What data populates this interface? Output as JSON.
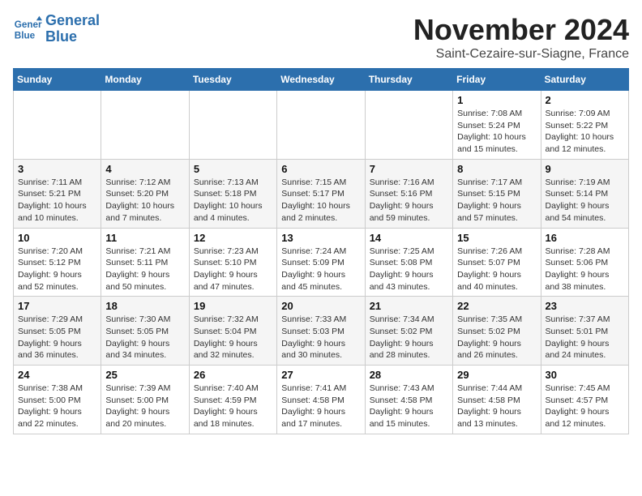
{
  "header": {
    "logo_line1": "General",
    "logo_line2": "Blue",
    "month": "November 2024",
    "location": "Saint-Cezaire-sur-Siagne, France"
  },
  "days_of_week": [
    "Sunday",
    "Monday",
    "Tuesday",
    "Wednesday",
    "Thursday",
    "Friday",
    "Saturday"
  ],
  "weeks": [
    [
      {
        "day": "",
        "info": ""
      },
      {
        "day": "",
        "info": ""
      },
      {
        "day": "",
        "info": ""
      },
      {
        "day": "",
        "info": ""
      },
      {
        "day": "",
        "info": ""
      },
      {
        "day": "1",
        "info": "Sunrise: 7:08 AM\nSunset: 5:24 PM\nDaylight: 10 hours and 15 minutes."
      },
      {
        "day": "2",
        "info": "Sunrise: 7:09 AM\nSunset: 5:22 PM\nDaylight: 10 hours and 12 minutes."
      }
    ],
    [
      {
        "day": "3",
        "info": "Sunrise: 7:11 AM\nSunset: 5:21 PM\nDaylight: 10 hours and 10 minutes."
      },
      {
        "day": "4",
        "info": "Sunrise: 7:12 AM\nSunset: 5:20 PM\nDaylight: 10 hours and 7 minutes."
      },
      {
        "day": "5",
        "info": "Sunrise: 7:13 AM\nSunset: 5:18 PM\nDaylight: 10 hours and 4 minutes."
      },
      {
        "day": "6",
        "info": "Sunrise: 7:15 AM\nSunset: 5:17 PM\nDaylight: 10 hours and 2 minutes."
      },
      {
        "day": "7",
        "info": "Sunrise: 7:16 AM\nSunset: 5:16 PM\nDaylight: 9 hours and 59 minutes."
      },
      {
        "day": "8",
        "info": "Sunrise: 7:17 AM\nSunset: 5:15 PM\nDaylight: 9 hours and 57 minutes."
      },
      {
        "day": "9",
        "info": "Sunrise: 7:19 AM\nSunset: 5:14 PM\nDaylight: 9 hours and 54 minutes."
      }
    ],
    [
      {
        "day": "10",
        "info": "Sunrise: 7:20 AM\nSunset: 5:12 PM\nDaylight: 9 hours and 52 minutes."
      },
      {
        "day": "11",
        "info": "Sunrise: 7:21 AM\nSunset: 5:11 PM\nDaylight: 9 hours and 50 minutes."
      },
      {
        "day": "12",
        "info": "Sunrise: 7:23 AM\nSunset: 5:10 PM\nDaylight: 9 hours and 47 minutes."
      },
      {
        "day": "13",
        "info": "Sunrise: 7:24 AM\nSunset: 5:09 PM\nDaylight: 9 hours and 45 minutes."
      },
      {
        "day": "14",
        "info": "Sunrise: 7:25 AM\nSunset: 5:08 PM\nDaylight: 9 hours and 43 minutes."
      },
      {
        "day": "15",
        "info": "Sunrise: 7:26 AM\nSunset: 5:07 PM\nDaylight: 9 hours and 40 minutes."
      },
      {
        "day": "16",
        "info": "Sunrise: 7:28 AM\nSunset: 5:06 PM\nDaylight: 9 hours and 38 minutes."
      }
    ],
    [
      {
        "day": "17",
        "info": "Sunrise: 7:29 AM\nSunset: 5:05 PM\nDaylight: 9 hours and 36 minutes."
      },
      {
        "day": "18",
        "info": "Sunrise: 7:30 AM\nSunset: 5:05 PM\nDaylight: 9 hours and 34 minutes."
      },
      {
        "day": "19",
        "info": "Sunrise: 7:32 AM\nSunset: 5:04 PM\nDaylight: 9 hours and 32 minutes."
      },
      {
        "day": "20",
        "info": "Sunrise: 7:33 AM\nSunset: 5:03 PM\nDaylight: 9 hours and 30 minutes."
      },
      {
        "day": "21",
        "info": "Sunrise: 7:34 AM\nSunset: 5:02 PM\nDaylight: 9 hours and 28 minutes."
      },
      {
        "day": "22",
        "info": "Sunrise: 7:35 AM\nSunset: 5:02 PM\nDaylight: 9 hours and 26 minutes."
      },
      {
        "day": "23",
        "info": "Sunrise: 7:37 AM\nSunset: 5:01 PM\nDaylight: 9 hours and 24 minutes."
      }
    ],
    [
      {
        "day": "24",
        "info": "Sunrise: 7:38 AM\nSunset: 5:00 PM\nDaylight: 9 hours and 22 minutes."
      },
      {
        "day": "25",
        "info": "Sunrise: 7:39 AM\nSunset: 5:00 PM\nDaylight: 9 hours and 20 minutes."
      },
      {
        "day": "26",
        "info": "Sunrise: 7:40 AM\nSunset: 4:59 PM\nDaylight: 9 hours and 18 minutes."
      },
      {
        "day": "27",
        "info": "Sunrise: 7:41 AM\nSunset: 4:58 PM\nDaylight: 9 hours and 17 minutes."
      },
      {
        "day": "28",
        "info": "Sunrise: 7:43 AM\nSunset: 4:58 PM\nDaylight: 9 hours and 15 minutes."
      },
      {
        "day": "29",
        "info": "Sunrise: 7:44 AM\nSunset: 4:58 PM\nDaylight: 9 hours and 13 minutes."
      },
      {
        "day": "30",
        "info": "Sunrise: 7:45 AM\nSunset: 4:57 PM\nDaylight: 9 hours and 12 minutes."
      }
    ]
  ]
}
